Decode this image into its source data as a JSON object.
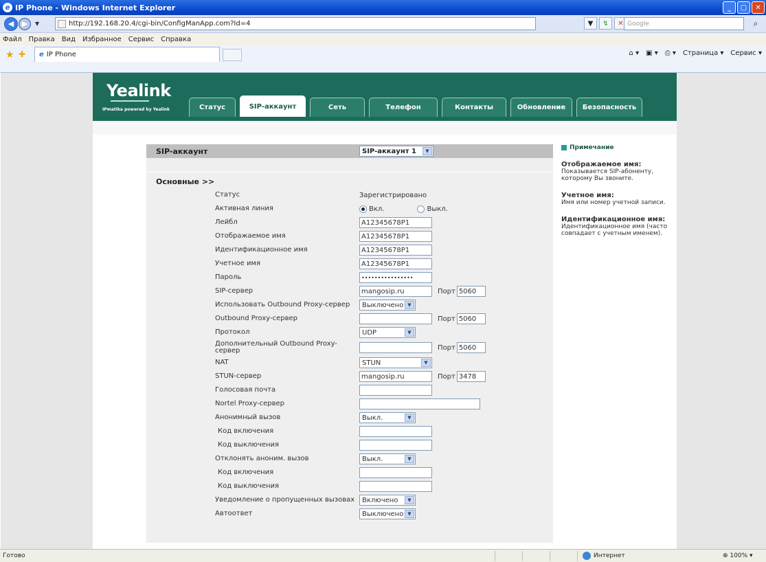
{
  "window": {
    "title": "IP Phone - Windows Internet Explorer"
  },
  "address": {
    "url": "http://192.168.20.4/cgi-bin/ConfigManApp.com?Id=4",
    "search_placeholder": "Google"
  },
  "menu": [
    "Файл",
    "Правка",
    "Вид",
    "Избранное",
    "Сервис",
    "Справка"
  ],
  "tab": {
    "label": "IP Phone"
  },
  "commands": {
    "page": "Страница",
    "tools": "Сервис"
  },
  "brand": {
    "logo": "Yealink",
    "tagline": "IPmatika powered by Yealink"
  },
  "nav": [
    "Статус",
    "SIP-аккаунт",
    "Сеть",
    "Телефон",
    "Контакты",
    "Обновление",
    "Безопасность"
  ],
  "section": {
    "title": "SIP-аккаунт",
    "account_select": "SIP-аккаунт 1",
    "basic": "Основные >>"
  },
  "fields": {
    "status": {
      "label": "Статус",
      "value": "Зарегистрировано"
    },
    "active": {
      "label": "Активная линия",
      "on": "Вкл.",
      "off": "Выкл."
    },
    "label": {
      "label": "Лейбл",
      "value": "A12345678P1"
    },
    "display_name": {
      "label": "Отображаемое имя",
      "value": "A12345678P1"
    },
    "auth_name": {
      "label": "Идентификационное имя",
      "value": "A12345678P1"
    },
    "user_name": {
      "label": "Учетное имя",
      "value": "A12345678P1"
    },
    "password": {
      "label": "Пароль",
      "value": "••••••••••••••••"
    },
    "sip_server": {
      "label": "SIP-сервер",
      "value": "mangosip.ru",
      "port_label": "Порт",
      "port": "5060"
    },
    "use_outbound": {
      "label": "Использовать Outbound Proxy-сервер",
      "value": "Выключено"
    },
    "outbound": {
      "label": "Outbound Proxy-сервер",
      "value": "",
      "port_label": "Порт",
      "port": "5060"
    },
    "protocol": {
      "label": "Протокол",
      "value": "UDP"
    },
    "backup_outbound": {
      "label": "Дополнительный Outbound Proxy-сервер",
      "value": "",
      "port_label": "Порт",
      "port": "5060"
    },
    "nat": {
      "label": "NAT",
      "value": "STUN"
    },
    "stun": {
      "label": "STUN-сервер",
      "value": "mangosip.ru",
      "port_label": "Порт",
      "port": "3478"
    },
    "voicemail": {
      "label": "Голосовая почта",
      "value": ""
    },
    "nortel": {
      "label": "Nortel Proxy-сервер",
      "value": ""
    },
    "anon_call": {
      "label": "Анонимный вызов",
      "value": "Выкл."
    },
    "anon_on_code": {
      "label": "Код включения",
      "value": ""
    },
    "anon_off_code": {
      "label": "Код выключения",
      "value": ""
    },
    "reject_anon": {
      "label": "Отклонять аноним. вызов",
      "value": "Выкл."
    },
    "reject_on_code": {
      "label": "Код включения",
      "value": ""
    },
    "reject_off_code": {
      "label": "Код выключения",
      "value": ""
    },
    "missed": {
      "label": "Уведомление о пропущенных вызовах",
      "value": "Включено"
    },
    "auto_answer": {
      "label": "Автоответ",
      "value": "Выключено"
    }
  },
  "notes": {
    "header": "Примечание",
    "t1": "Отображаемое имя:",
    "d1": "Показывается SIP-абоненту, которому Вы звоните.",
    "t2": "Учетное имя:",
    "d2": "Имя или номер учетной записи.",
    "t3": "Идентификационное имя:",
    "d3": "Идентификационное имя (часто совпадает с учетным именем)."
  },
  "status": {
    "text": "Готово",
    "zone": "Интернет",
    "zoom": "100%"
  }
}
